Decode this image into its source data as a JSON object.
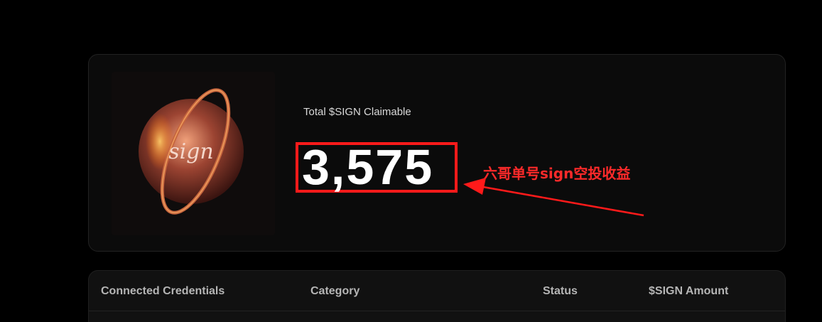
{
  "claim": {
    "label": "Total $SIGN Claimable",
    "amount": "3,575"
  },
  "annotation": {
    "text": "六哥单号sign空投收益",
    "color": "#ff1a1a"
  },
  "credentials_table": {
    "columns": [
      "Connected Credentials",
      "Category",
      "Status",
      "$SIGN Amount"
    ]
  },
  "icons": {
    "artwork": "sign-orb-icon"
  }
}
